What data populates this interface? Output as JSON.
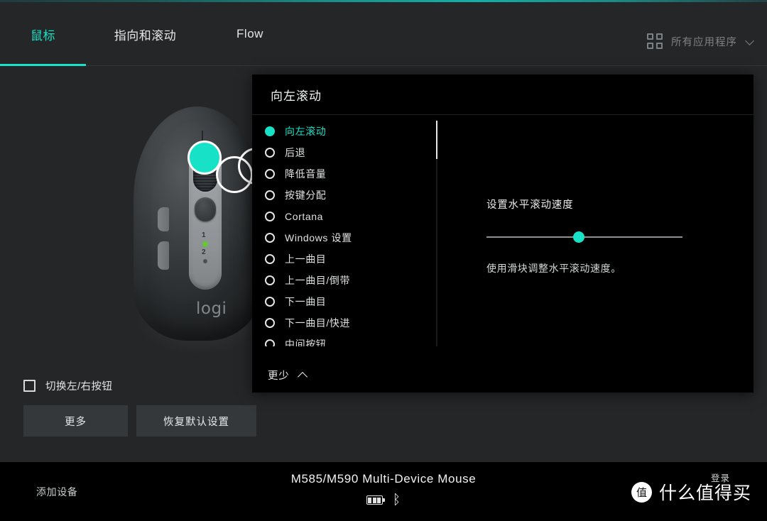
{
  "window": {
    "minimize_label": "—",
    "close_label": "✕",
    "accent_color": "#17e2c8",
    "background_color": "#242628",
    "panel_background": "#000000"
  },
  "tabs": [
    {
      "label": "鼠标",
      "active": true
    },
    {
      "label": "指向和滚动",
      "active": false
    },
    {
      "label": "Flow",
      "active": false
    }
  ],
  "app_selector": {
    "icon": "grid-icon",
    "label": "所有应用程序",
    "chevron": "chevron-down-icon"
  },
  "device_illustration": {
    "brand_text": "logi",
    "channel_1": "1",
    "channel_2": "2",
    "hotspots": [
      {
        "name": "left-button-hotspot",
        "state": "selected"
      },
      {
        "name": "scroll-wheel-hotspot",
        "state": "unselected"
      },
      {
        "name": "right-tilt-hotspot",
        "state": "unselected"
      }
    ]
  },
  "left_controls": {
    "swap_buttons_label": "切换左/右按钮",
    "swap_buttons_checked": false,
    "more_button": "更多",
    "restore_defaults_button": "恢复默认设置"
  },
  "panel": {
    "title": "向左滚动",
    "options": [
      {
        "label": "向左滚动",
        "selected": true
      },
      {
        "label": "后退",
        "selected": false
      },
      {
        "label": "降低音量",
        "selected": false
      },
      {
        "label": "按键分配",
        "selected": false
      },
      {
        "label": "Cortana",
        "selected": false
      },
      {
        "label": "Windows 设置",
        "selected": false
      },
      {
        "label": "上一曲目",
        "selected": false
      },
      {
        "label": "上一曲目/倒带",
        "selected": false
      },
      {
        "label": "下一曲目",
        "selected": false
      },
      {
        "label": "下一曲目/快进",
        "selected": false
      },
      {
        "label": "中间按钮",
        "selected": false
      }
    ],
    "detail": {
      "title": "设置水平滚动速度",
      "hint": "使用滑块调整水平滚动速度。",
      "slider_value_percent": 47
    },
    "collapse_label": "更少",
    "collapse_icon": "chevron-up-icon"
  },
  "bottom_bar": {
    "add_device_label": "添加设备",
    "device_name": "M585/M590 Multi-Device Mouse",
    "battery_icon": "battery-icon",
    "bluetooth_icon": "bluetooth-icon",
    "bluetooth_glyph": "ᛒ",
    "login_label": "登录",
    "watermark_logo": "值",
    "watermark_text": "什么值得买"
  }
}
